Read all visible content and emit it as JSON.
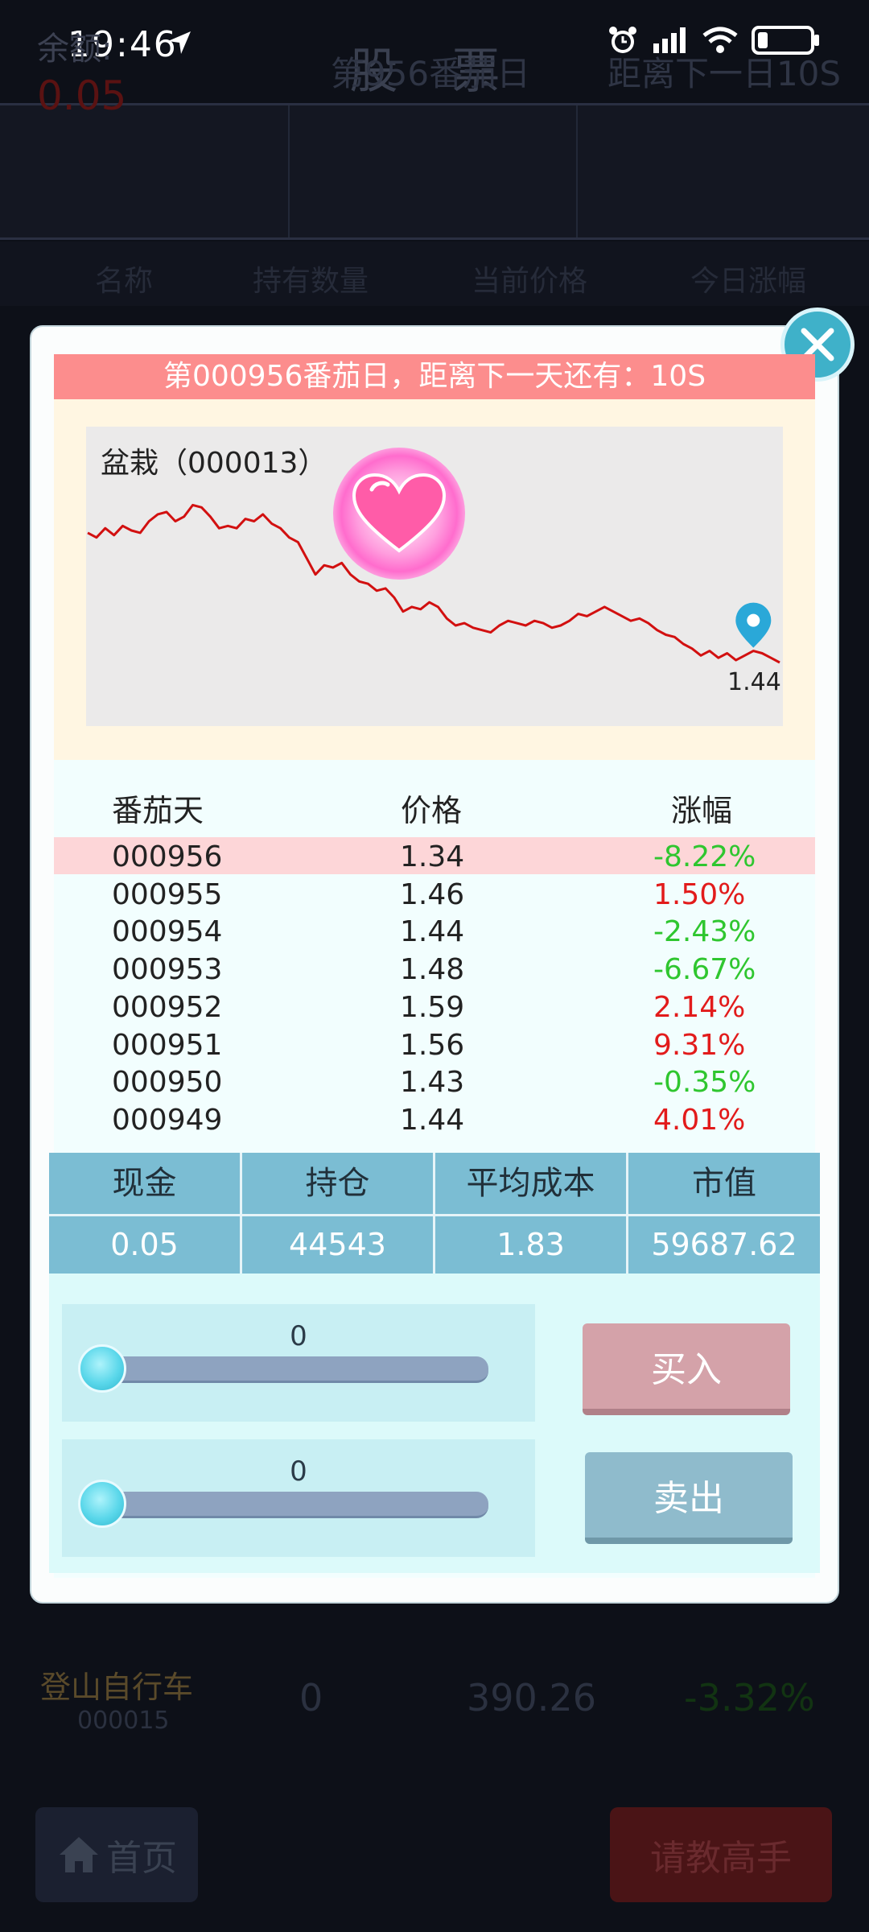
{
  "status_bar": {
    "time": "19:46"
  },
  "app": {
    "title": "股 票",
    "balance_label": "余额:",
    "balance_value": "0.05",
    "day_label": "第956番茄日",
    "next_label": "距离下一日10S",
    "columns": [
      "名称",
      "持有数量",
      "当前价格",
      "今日涨幅"
    ],
    "background_row": {
      "name": "登山自行车",
      "code": "000015",
      "holding": "0",
      "price": "390.26",
      "change": "-3.32%"
    },
    "home_label": "首页",
    "ask_label": "请教高手"
  },
  "modal": {
    "banner": "第000956番茄日，距离下一天还有：10S",
    "chart_title": "盆栽（000013）",
    "table_headers": [
      "番茄天",
      "价格",
      "涨幅"
    ],
    "history": [
      {
        "day": "000956",
        "price": "1.34",
        "change": "-8.22%",
        "dir": "down"
      },
      {
        "day": "000955",
        "price": "1.46",
        "change": "1.50%",
        "dir": "up"
      },
      {
        "day": "000954",
        "price": "1.44",
        "change": "-2.43%",
        "dir": "down"
      },
      {
        "day": "000953",
        "price": "1.48",
        "change": "-6.67%",
        "dir": "down"
      },
      {
        "day": "000952",
        "price": "1.59",
        "change": "2.14%",
        "dir": "up"
      },
      {
        "day": "000951",
        "price": "1.56",
        "change": "9.31%",
        "dir": "up"
      },
      {
        "day": "000950",
        "price": "1.43",
        "change": "-0.35%",
        "dir": "down"
      },
      {
        "day": "000949",
        "price": "1.44",
        "change": "4.01%",
        "dir": "up"
      }
    ],
    "stats_headers": [
      "现金",
      "持仓",
      "平均成本",
      "市值"
    ],
    "stats_values": [
      "0.05",
      "44543",
      "1.83",
      "59687.62"
    ],
    "buy_slider_value": "0",
    "sell_slider_value": "0",
    "buy_label": "买入",
    "sell_label": "卖出"
  },
  "chart_data": {
    "type": "line",
    "title": "盆栽（000013）",
    "last_label": "1.44",
    "values": [
      2.1,
      2.08,
      2.12,
      2.09,
      2.13,
      2.11,
      2.1,
      2.15,
      2.18,
      2.19,
      2.15,
      2.17,
      2.22,
      2.21,
      2.17,
      2.12,
      2.13,
      2.12,
      2.16,
      2.15,
      2.18,
      2.14,
      2.12,
      2.08,
      2.06,
      1.99,
      1.92,
      1.96,
      1.95,
      1.97,
      1.92,
      1.89,
      1.88,
      1.85,
      1.86,
      1.82,
      1.76,
      1.78,
      1.77,
      1.8,
      1.78,
      1.73,
      1.7,
      1.71,
      1.69,
      1.68,
      1.67,
      1.7,
      1.72,
      1.71,
      1.7,
      1.72,
      1.71,
      1.69,
      1.7,
      1.72,
      1.75,
      1.74,
      1.76,
      1.78,
      1.76,
      1.74,
      1.72,
      1.73,
      1.71,
      1.68,
      1.66,
      1.65,
      1.62,
      1.6,
      1.57,
      1.59,
      1.56,
      1.58,
      1.55,
      1.57,
      1.59,
      1.58,
      1.56,
      1.54
    ],
    "ylim": [
      1.3,
      2.35
    ],
    "colors": {
      "line": "#d21010",
      "pin": "#2aa8d8"
    }
  },
  "colors": {
    "up": "#e21b1b",
    "down": "#2fc62f",
    "banner": "#fc8d8d"
  }
}
